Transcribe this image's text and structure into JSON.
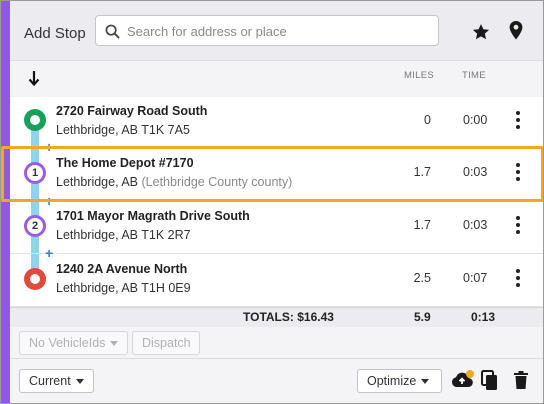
{
  "header": {
    "add_stop_label": "Add Stop",
    "search_placeholder": "Search for address or place",
    "search_value": "",
    "star_icon": "star-icon",
    "pin_icon": "map-pin-icon"
  },
  "columns": {
    "miles": "MILES",
    "time": "TIME"
  },
  "stops": [
    {
      "marker": "start",
      "name": "2720 Fairway Road South",
      "address": "Lethbridge, AB T1K 7A5",
      "county": "",
      "miles": "0",
      "time": "0:00"
    },
    {
      "marker": "1",
      "name": "The Home Depot #7170",
      "address": "Lethbridge, AB",
      "county": "(Lethbridge County county)",
      "miles": "1.7",
      "time": "0:03",
      "highlighted": true
    },
    {
      "marker": "2",
      "name": "1701 Mayor Magrath Drive South",
      "address": "Lethbridge, AB T1K 2R7",
      "county": "",
      "miles": "1.7",
      "time": "0:03"
    },
    {
      "marker": "end",
      "name": "1240 2A Avenue North",
      "address": "Lethbridge, AB T1H 0E9",
      "county": "",
      "miles": "2.5",
      "time": "0:07"
    }
  ],
  "totals": {
    "label": "TOTALS: $16.43",
    "miles": "5.9",
    "time": "0:13"
  },
  "actions": {
    "vehicle_select": "No VehicleIds",
    "dispatch": "Dispatch",
    "current_select": "Current",
    "optimize_select": "Optimize"
  },
  "colors": {
    "accent": "#8e59e3",
    "route_line": "#8fd3ef",
    "start_marker": "#19a05a",
    "end_marker": "#e04a3a",
    "stop_marker_border": "#9a5ee0",
    "highlight": "#f5a623",
    "notification_dot": "#f5a623"
  }
}
